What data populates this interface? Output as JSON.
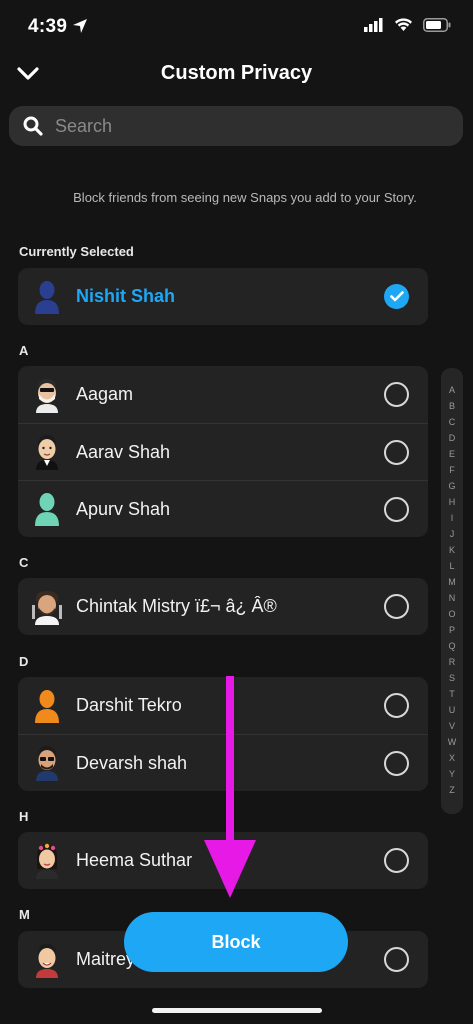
{
  "status_bar": {
    "time": "4:39"
  },
  "header": {
    "title": "Custom Privacy",
    "back_icon": "chevron-down-icon"
  },
  "search": {
    "placeholder": "Search",
    "value": ""
  },
  "description": "Block friends from seeing new Snaps you add to your Story.",
  "sections": [
    {
      "label": "Currently Selected",
      "items": [
        {
          "name": "Nishit Shah",
          "selected": true,
          "avatar": "silhouette-avatar",
          "avatar_color": "#2a3f8f"
        }
      ]
    },
    {
      "label": "A",
      "items": [
        {
          "name": "Aagam",
          "selected": false,
          "avatar": "bitmoji-mask-avatar"
        },
        {
          "name": "Aarav Shah",
          "selected": false,
          "avatar": "bitmoji-suit-avatar"
        },
        {
          "name": "Apurv Shah",
          "selected": false,
          "avatar": "silhouette-avatar",
          "avatar_color": "#6fd3b5"
        }
      ]
    },
    {
      "label": "C",
      "items": [
        {
          "name": "Chintak Mistry ï£¬ â¿ Â®",
          "selected": false,
          "avatar": "bitmoji-chef-avatar"
        }
      ]
    },
    {
      "label": "D",
      "items": [
        {
          "name": "Darshit Tekro",
          "selected": false,
          "avatar": "silhouette-avatar",
          "avatar_color": "#f08a1c"
        },
        {
          "name": "Devarsh shah",
          "selected": false,
          "avatar": "bitmoji-glasses-avatar"
        }
      ]
    },
    {
      "label": "H",
      "items": [
        {
          "name": "Heema Suthar",
          "selected": false,
          "avatar": "bitmoji-flower-avatar"
        }
      ]
    },
    {
      "label": "M",
      "items": [
        {
          "name": "Maitrey",
          "selected": false,
          "avatar": "bitmoji-avatar"
        }
      ]
    }
  ],
  "alpha_index": [
    "A",
    "B",
    "C",
    "D",
    "E",
    "F",
    "G",
    "H",
    "I",
    "J",
    "K",
    "L",
    "M",
    "N",
    "O",
    "P",
    "Q",
    "R",
    "S",
    "T",
    "U",
    "V",
    "W",
    "X",
    "Y",
    "Z"
  ],
  "block_button": {
    "label": "Block"
  },
  "colors": {
    "accent": "#1ea7f4",
    "annotation": "#e619e6",
    "background": "#141414",
    "card": "#232323"
  }
}
